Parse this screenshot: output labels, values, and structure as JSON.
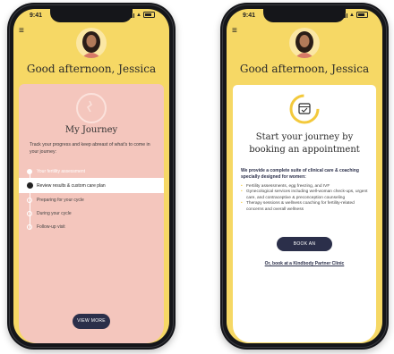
{
  "status": {
    "time": "9:41"
  },
  "left_screen": {
    "greeting": "Good afternoon, Jessica",
    "journey_title": "My Journey",
    "journey_subtitle": "Track your progress and keep abreast of what's to come in your journey:",
    "steps": [
      {
        "label": "Your fertility assessment",
        "state": "done"
      },
      {
        "label": "Review results & custom care plan",
        "state": "active"
      },
      {
        "label": "Preparing for your cycle",
        "state": "upcoming"
      },
      {
        "label": "During your cycle",
        "state": "upcoming"
      },
      {
        "label": "Follow-up visit",
        "state": "upcoming"
      }
    ],
    "view_more": "VIEW MORE",
    "card_color": "#f4c6bd"
  },
  "right_screen": {
    "greeting": "Good afternoon, Jessica",
    "title_line1": "Start your journey by",
    "title_line2": "booking an appointment",
    "provide_text": "We provide a complete suite of clinical care & coaching specially designed for women:",
    "services": [
      "Fertility assessments, egg freezing, and IVF",
      "Gynecological services including well-woman check-ups, urgent care, and contraceptive & preconception counseling",
      "Therapy sessions & wellness coaching for fertility-related concerns and overall wellness"
    ],
    "book_button": "BOOK AN APPOINTMENT",
    "partner_link": "Or, book at a Kindbody Partner Clinic"
  },
  "colors": {
    "header_yellow": "#f6d865",
    "navy": "#2b2f4a",
    "accent_yellow": "#f3c93c"
  }
}
